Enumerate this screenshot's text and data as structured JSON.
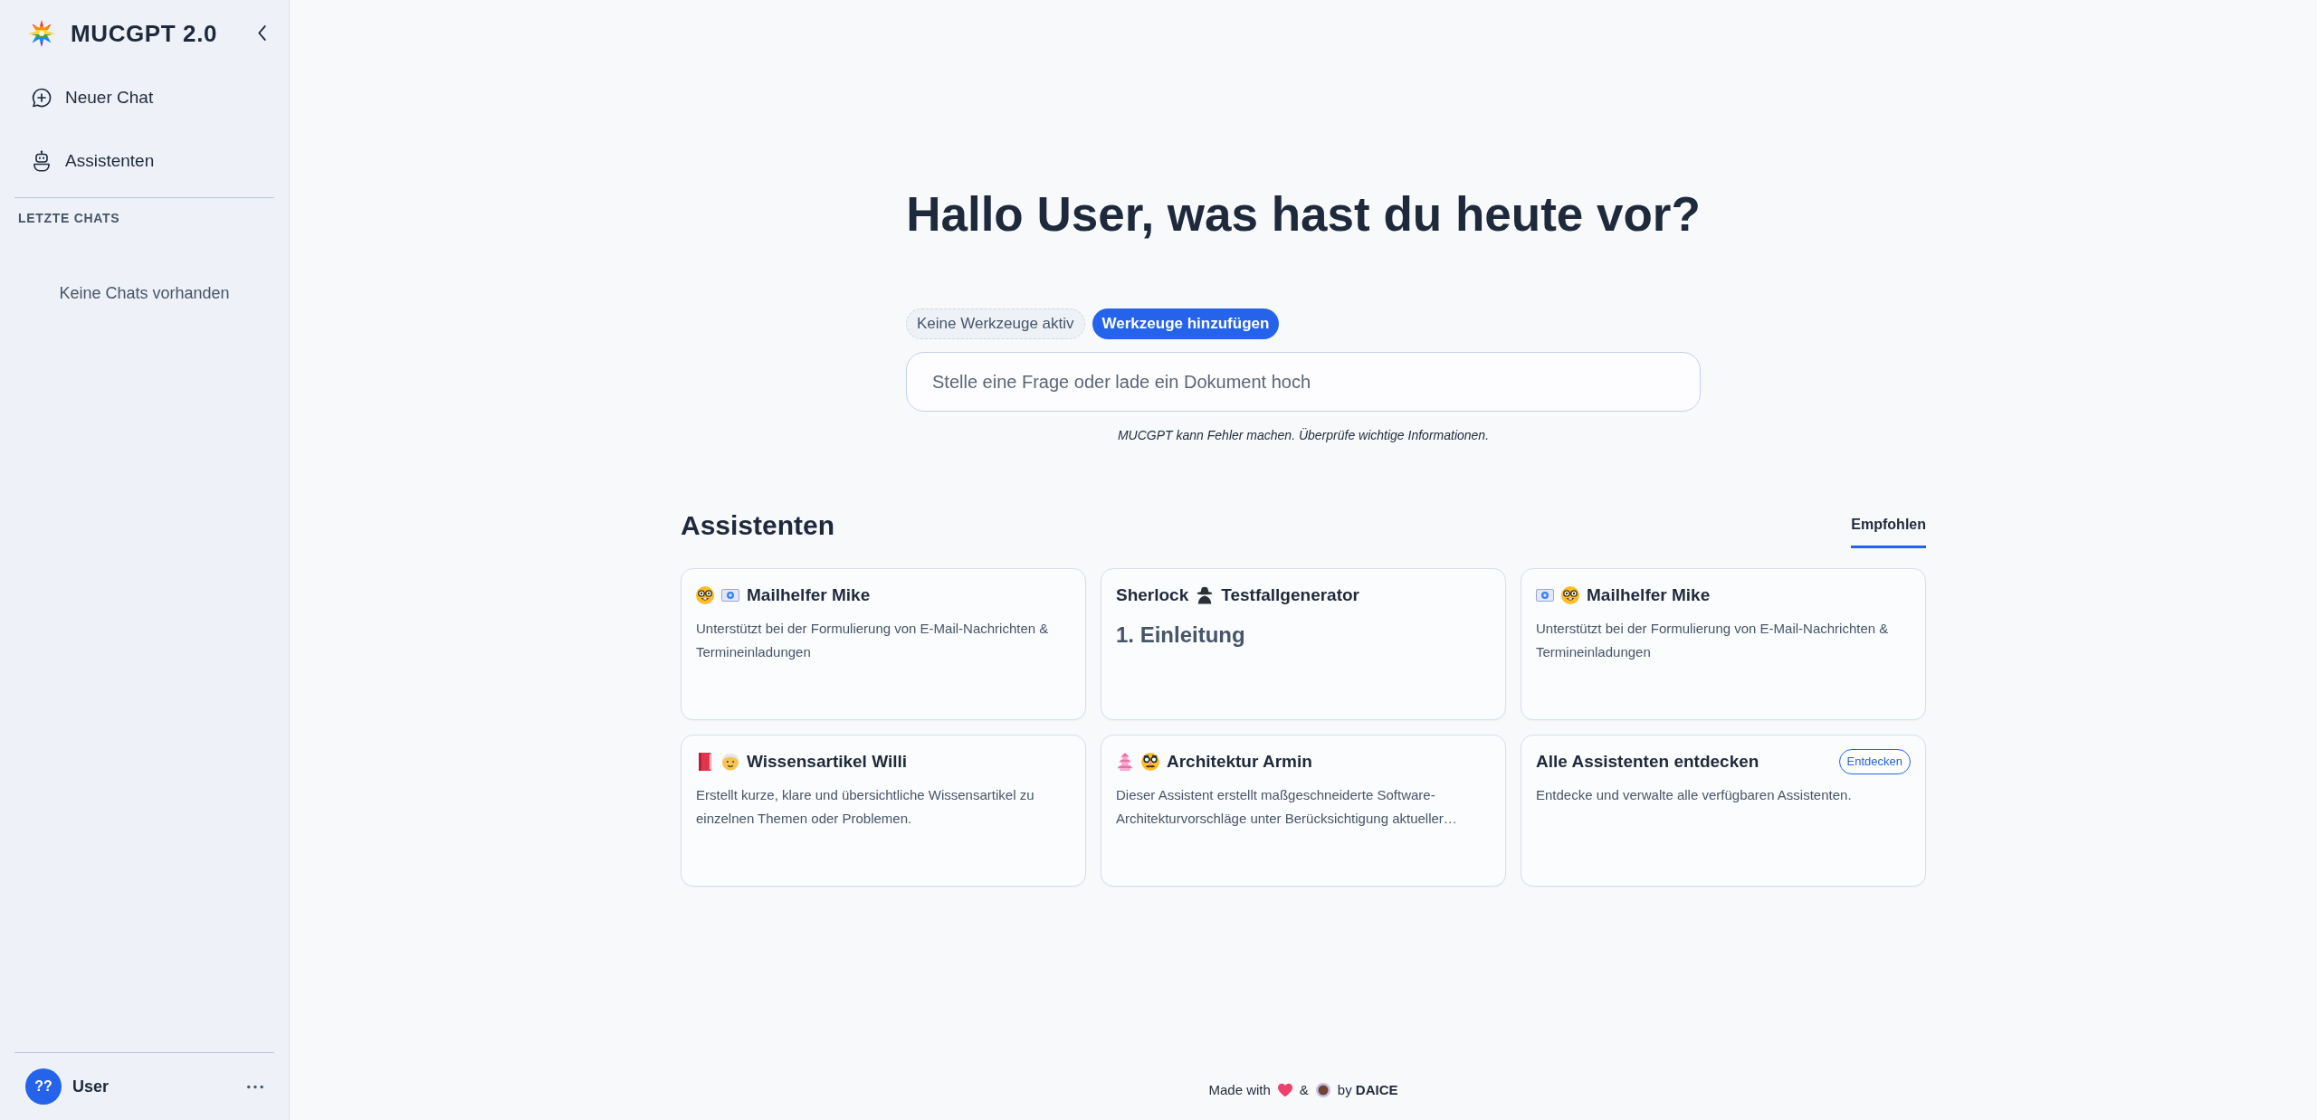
{
  "sidebar": {
    "brand": "MUCGPT 2.0",
    "nav": [
      {
        "label": "Neuer Chat"
      },
      {
        "label": "Assistenten"
      }
    ],
    "section_title": "LETZTE CHATS",
    "empty_text": "Keine Chats vorhanden",
    "user": {
      "initials": "??",
      "name": "User"
    }
  },
  "main": {
    "greeting": "Hallo User, was hast du heute vor?",
    "tools": [
      {
        "kind": "status",
        "label": "Keine Werkzeuge aktiv"
      },
      {
        "kind": "action",
        "label": "Werkzeuge hinzufügen"
      }
    ],
    "prompt": {
      "placeholder": "Stelle eine Frage oder lade ein Dokument hoch"
    },
    "disclaimer": "MUCGPT kann Fehler machen. Überprüfe wichtige Informationen."
  },
  "assistants": {
    "title": "Assistenten",
    "tabs": [
      {
        "label": "Empfohlen",
        "selected": true
      }
    ],
    "cards": [
      {
        "kind": "assistant",
        "title": [
          {
            "kind": "nerd"
          },
          {
            "kind": "envelope"
          },
          {
            "kind": "text",
            "text": "Mailhelfer Mike"
          }
        ],
        "description": {
          "kind": "paragraph",
          "text": "Unterstützt bei der Formulierung von E-Mail-Nachrichten & Termineinladungen"
        }
      },
      {
        "kind": "assistant",
        "title": [
          {
            "kind": "text",
            "text": "Sherlock"
          },
          {
            "kind": "detective"
          },
          {
            "kind": "text",
            "text": "Testfallgenerator"
          }
        ],
        "description": {
          "kind": "heading",
          "text": "1. Einleitung"
        }
      },
      {
        "kind": "assistant",
        "title": [
          {
            "kind": "envelope"
          },
          {
            "kind": "nerd"
          },
          {
            "kind": "text",
            "text": "Mailhelfer Mike"
          }
        ],
        "description": {
          "kind": "paragraph",
          "text": "Unterstützt bei der Formulierung von E-Mail-Nachrichten & Termineinladungen"
        }
      },
      {
        "kind": "assistant",
        "title": [
          {
            "kind": "book"
          },
          {
            "kind": "elder"
          },
          {
            "kind": "text",
            "text": "Wissensartikel Willi"
          }
        ],
        "description": {
          "kind": "paragraph",
          "text": "Erstellt kurze, klare und übersichtliche Wissensartikel zu einzelnen Themen oder Problemen."
        }
      },
      {
        "kind": "assistant",
        "title": [
          {
            "kind": "pagoda"
          },
          {
            "kind": "disguise"
          },
          {
            "kind": "text",
            "text": "Architektur Armin"
          }
        ],
        "description": {
          "kind": "paragraph",
          "text": "Dieser Assistent erstellt maßgeschneiderte Software-Architekturvorschläge unter Berücksichtigung aktueller…"
        }
      },
      {
        "kind": "explore",
        "title": [
          {
            "kind": "text",
            "text": "Alle Assistenten entdecken"
          }
        ],
        "action": "Entdecken",
        "description": {
          "kind": "paragraph",
          "text": "Entdecke und verwalte alle verfügbaren Assistenten."
        }
      }
    ]
  },
  "footer": [
    {
      "kind": "text",
      "text": "Made with"
    },
    {
      "kind": "heart"
    },
    {
      "kind": "text",
      "text": "&"
    },
    {
      "kind": "coffee"
    },
    {
      "kind": "text",
      "text": "by **DAICE**"
    }
  ]
}
